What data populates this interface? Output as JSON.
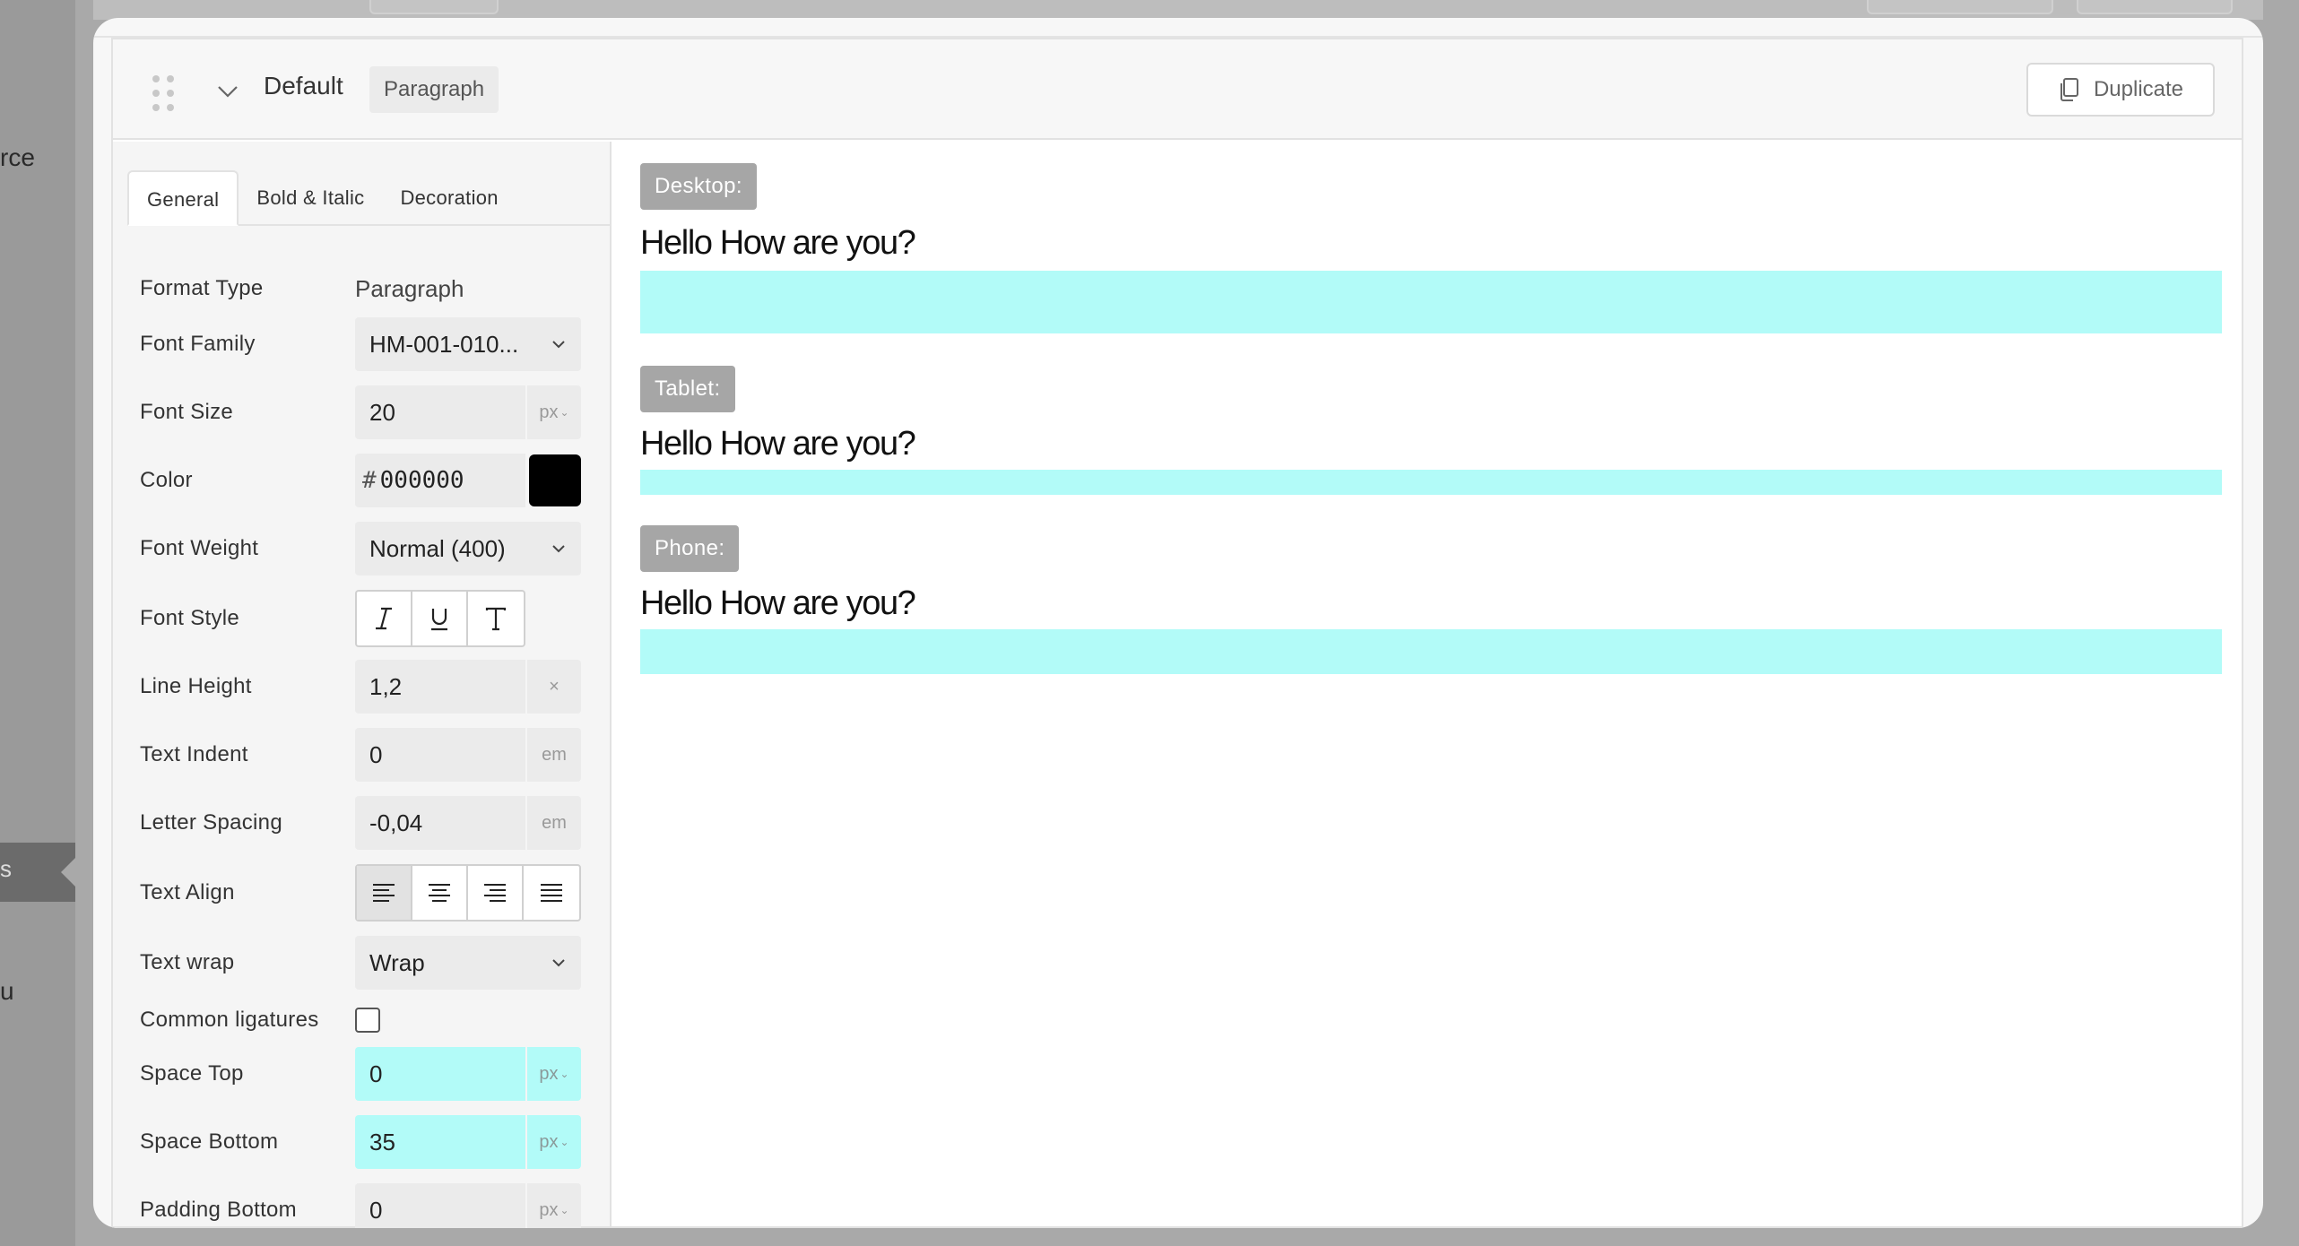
{
  "background": {
    "left_text_1": "rce",
    "left_text_2": "s",
    "left_text_3": "u"
  },
  "header": {
    "title": "Default",
    "badge": "Paragraph",
    "duplicate_label": "Duplicate"
  },
  "tabs": [
    "General",
    "Bold & Italic",
    "Decoration"
  ],
  "settings": {
    "format_type": {
      "label": "Format Type",
      "value": "Paragraph"
    },
    "font_family": {
      "label": "Font Family",
      "value": "HM-001-010..."
    },
    "font_size": {
      "label": "Font Size",
      "value": "20",
      "unit": "px"
    },
    "color": {
      "label": "Color",
      "hash": "#",
      "value": "000000",
      "swatch": "#000000"
    },
    "font_weight": {
      "label": "Font Weight",
      "value": "Normal (400)"
    },
    "font_style": {
      "label": "Font Style",
      "icons": [
        "italic-icon",
        "underline-icon",
        "text-transform-icon"
      ]
    },
    "line_height": {
      "label": "Line Height",
      "value": "1,2",
      "unit": "×"
    },
    "text_indent": {
      "label": "Text Indent",
      "value": "0",
      "unit": "em"
    },
    "letter_spacing": {
      "label": "Letter Spacing",
      "value": "-0,04",
      "unit": "em"
    },
    "text_align": {
      "label": "Text Align",
      "selected": "left"
    },
    "text_wrap": {
      "label": "Text wrap",
      "value": "Wrap"
    },
    "common_ligatures": {
      "label": "Common ligatures",
      "checked": false
    },
    "space_top": {
      "label": "Space Top",
      "value": "0",
      "unit": "px"
    },
    "space_bottom": {
      "label": "Space Bottom",
      "value": "35",
      "unit": "px"
    },
    "padding_bottom": {
      "label": "Padding Bottom",
      "value": "0",
      "unit": "px"
    }
  },
  "preview": {
    "desktop": {
      "label": "Desktop:",
      "sample": "Hello How are you?"
    },
    "tablet": {
      "label": "Tablet:",
      "sample": "Hello How are you?"
    },
    "phone": {
      "label": "Phone:",
      "sample": "Hello How are you?"
    }
  },
  "colors": {
    "space_highlight": "#b2fbf8",
    "device_tag": "#a6a6a6"
  }
}
